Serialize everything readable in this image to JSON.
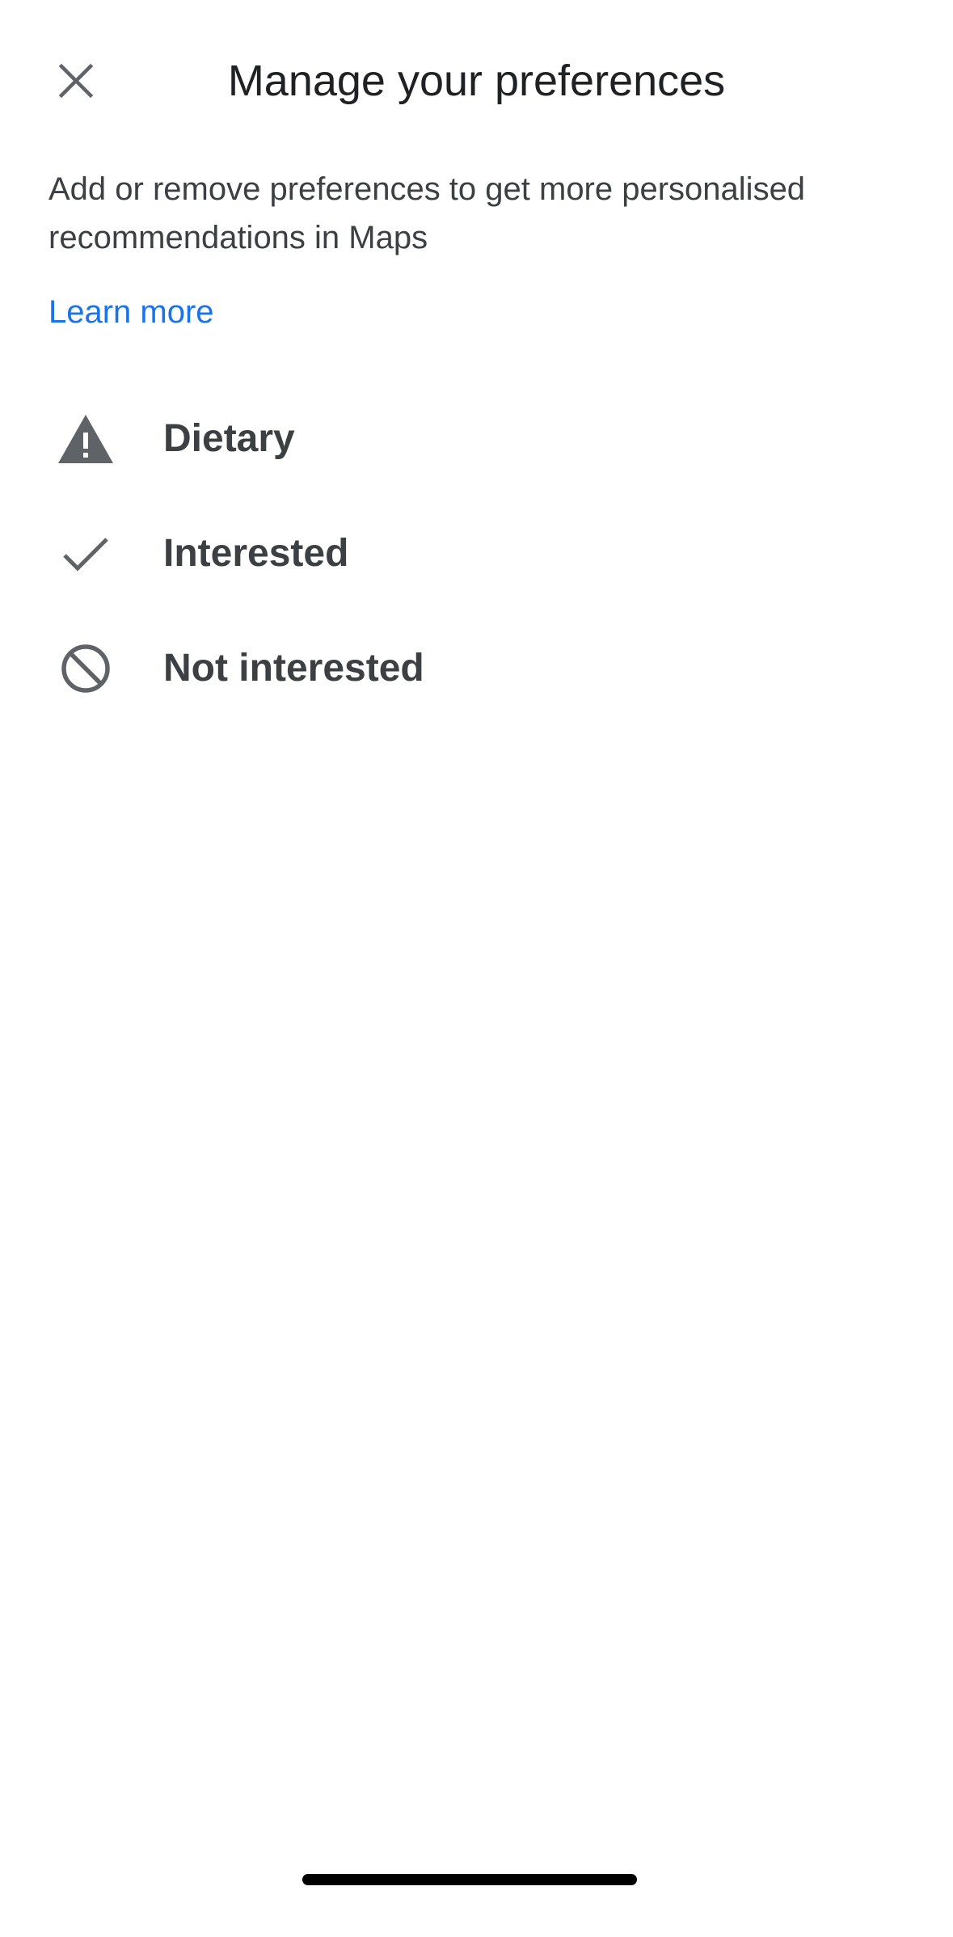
{
  "header": {
    "title": "Manage your preferences",
    "close_icon": "close-icon"
  },
  "description": "Add or remove preferences to get more personalised recommendations in Maps",
  "learn_more": "Learn more",
  "preferences": [
    {
      "label": "Dietary",
      "icon": "warning-icon"
    },
    {
      "label": "Interested",
      "icon": "check-icon"
    },
    {
      "label": "Not interested",
      "icon": "block-icon"
    }
  ],
  "colors": {
    "icon": "#5f6368",
    "link": "#1a73e8",
    "text": "#3c4043"
  }
}
